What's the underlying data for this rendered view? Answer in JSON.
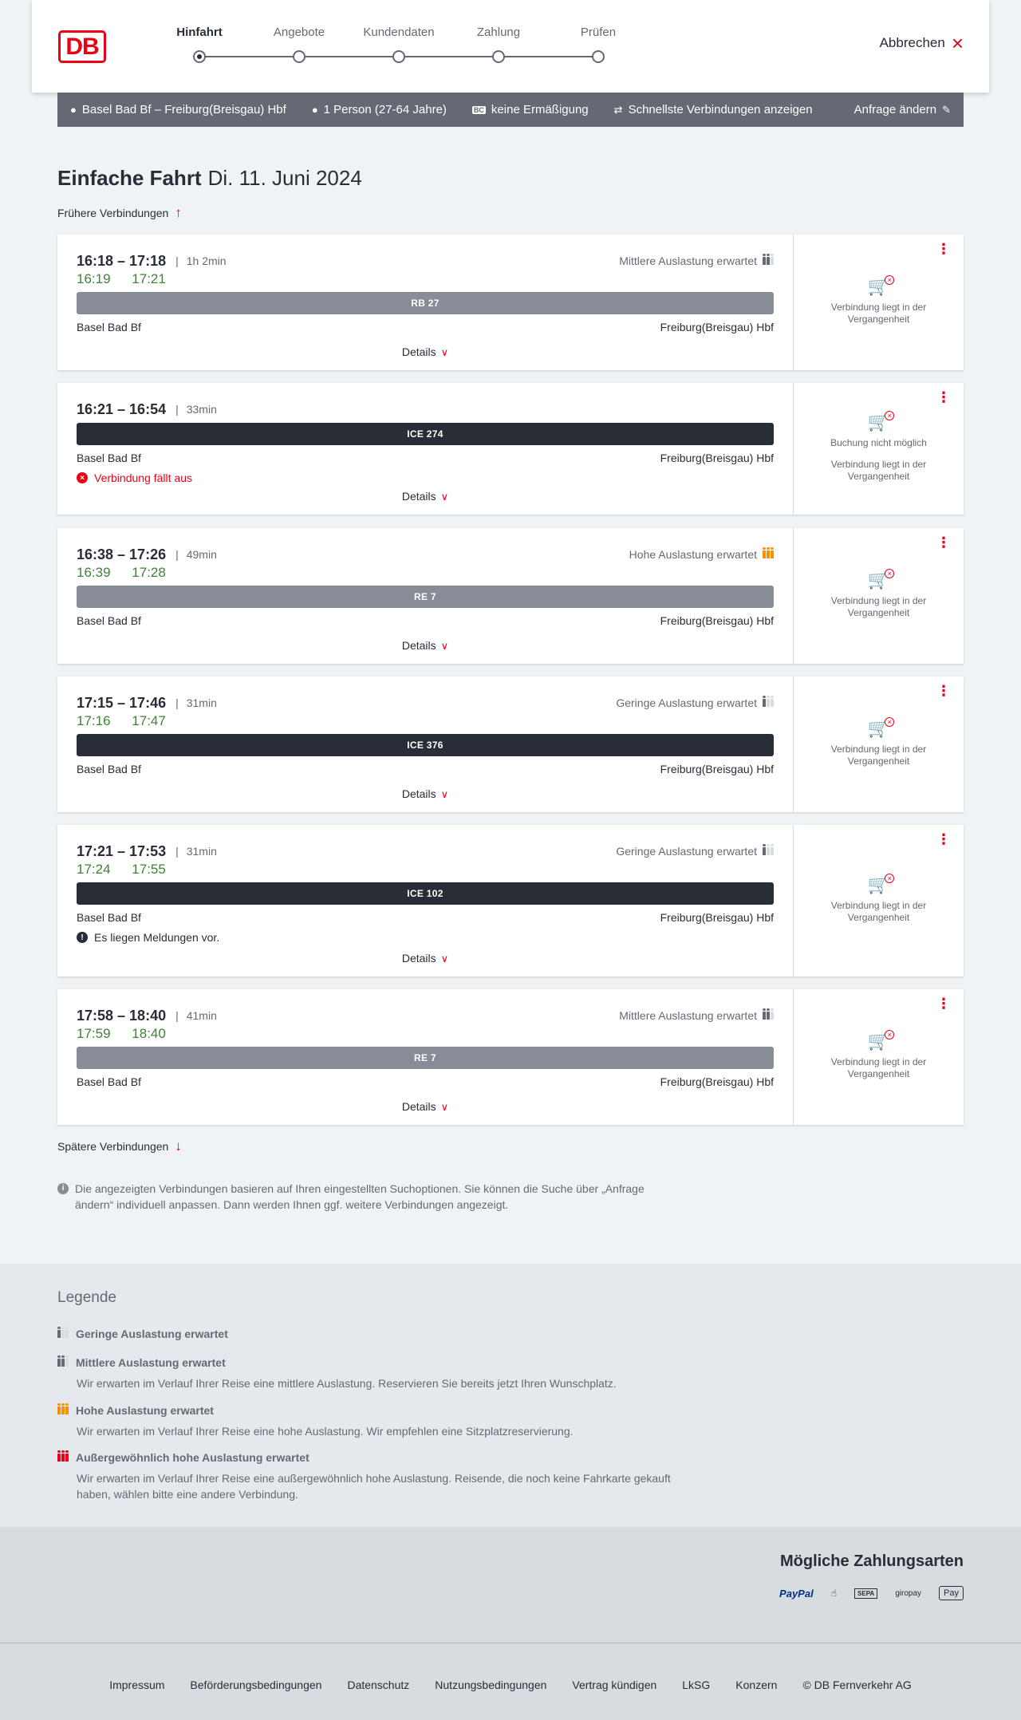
{
  "header": {
    "logo": "DB",
    "steps": [
      {
        "label": "Hinfahrt",
        "active": true
      },
      {
        "label": "Angebote"
      },
      {
        "label": "Kundendaten"
      },
      {
        "label": "Zahlung"
      },
      {
        "label": "Prüfen"
      }
    ],
    "cancel_label": "Abbrechen"
  },
  "summary": {
    "route": "Basel Bad Bf – Freiburg(Breisgau) Hbf",
    "passengers": "1 Person (27-64 Jahre)",
    "discount_icon": "BC",
    "discount": "keine Ermäßigung",
    "mode": "Schnellste Verbindungen anzeigen",
    "change": "Anfrage ändern"
  },
  "title": {
    "bold": "Einfache Fahrt",
    "date": "Di. 11. Juni 2024"
  },
  "earlier_label": "Frühere Verbindungen",
  "later_label": "Spätere Verbindungen",
  "details_label": "Details",
  "connections": [
    {
      "time": "16:18 – 17:18",
      "duration": "1h 2min",
      "load": "Mittlere Auslastung erwartet",
      "rt_dep": "16:19",
      "rt_arr": "17:21",
      "train": "RB 27",
      "from": "Basel Bad Bf",
      "to": "Freiburg(Breisgau) Hbf",
      "status": "Verbindung liegt in der Vergangenheit"
    },
    {
      "time": "16:21 – 16:54",
      "duration": "33min",
      "train": "ICE 274",
      "from": "Basel Bad Bf",
      "to": "Freiburg(Breisgau) Hbf",
      "notice": "Verbindung fällt aus",
      "status_top": "Buchung nicht möglich",
      "status": "Verbindung liegt in der Vergangenheit"
    },
    {
      "time": "16:38 – 17:26",
      "duration": "49min",
      "load": "Hohe Auslastung erwartet",
      "rt_dep": "16:39",
      "rt_arr": "17:28",
      "train": "RE 7",
      "from": "Basel Bad Bf",
      "to": "Freiburg(Breisgau) Hbf",
      "status": "Verbindung liegt in der Vergangenheit"
    },
    {
      "time": "17:15 – 17:46",
      "duration": "31min",
      "load": "Geringe Auslastung erwartet",
      "rt_dep": "17:16",
      "rt_arr": "17:47",
      "train": "ICE 376",
      "from": "Basel Bad Bf",
      "to": "Freiburg(Breisgau) Hbf",
      "status": "Verbindung liegt in der Vergangenheit"
    },
    {
      "time": "17:21 – 17:53",
      "duration": "31min",
      "load": "Geringe Auslastung erwartet",
      "rt_dep": "17:24",
      "rt_arr": "17:55",
      "train": "ICE 102",
      "from": "Basel Bad Bf",
      "to": "Freiburg(Breisgau) Hbf",
      "notice": "Es liegen Meldungen vor.",
      "status": "Verbindung liegt in der Vergangenheit"
    },
    {
      "time": "17:58 – 18:40",
      "duration": "41min",
      "load": "Mittlere Auslastung erwartet",
      "rt_dep": "17:59",
      "rt_arr": "18:40",
      "train": "RE 7",
      "from": "Basel Bad Bf",
      "to": "Freiburg(Breisgau) Hbf",
      "status": "Verbindung liegt in der Vergangenheit"
    }
  ],
  "info_text": "Die angezeigten Verbindungen basieren auf Ihren eingestellten Suchoptionen. Sie können die Suche über „Anfrage ändern“ individuell anpassen. Dann werden Ihnen ggf. weitere Verbindungen angezeigt.",
  "legend": {
    "title": "Legende",
    "items": [
      {
        "title": "Geringe Auslastung erwartet",
        "desc": ""
      },
      {
        "title": "Mittlere Auslastung erwartet",
        "desc": "Wir erwarten im Verlauf Ihrer Reise eine mittlere Auslastung. Reservieren Sie bereits jetzt Ihren Wunschplatz."
      },
      {
        "title": "Hohe Auslastung erwartet",
        "desc": "Wir erwarten im Verlauf Ihrer Reise eine hohe Auslastung. Wir empfehlen eine Sitzplatzreservierung."
      },
      {
        "title": "Außergewöhnlich hohe Auslastung erwartet",
        "desc": "Wir erwarten im Verlauf Ihrer Reise eine außergewöhnlich hohe Auslastung. Reisende, die noch keine Fahrkarte gekauft haben, wählen bitte eine andere Verbindung."
      }
    ]
  },
  "payment": {
    "title": "Mögliche Zahlungsarten",
    "methods": [
      "PayPal",
      "SEPA",
      "giropay",
      "Pay"
    ]
  },
  "footer": {
    "links": [
      "Impressum",
      "Beförderungsbedingungen",
      "Datenschutz",
      "Nutzungsbedingungen",
      "Vertrag kündigen",
      "LkSG",
      "Konzern",
      "© DB Fernverkehr AG"
    ]
  }
}
